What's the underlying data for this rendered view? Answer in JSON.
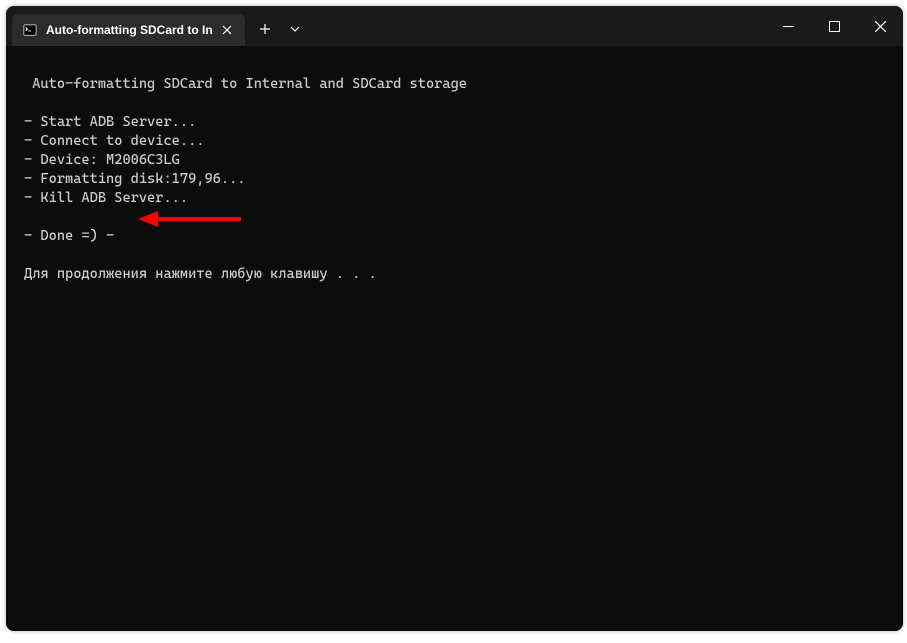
{
  "tab": {
    "title": "Auto-formatting SDCard to In"
  },
  "terminal": {
    "lines": [
      " Auto-formatting SDCard to Internal and SDCard storage",
      "",
      "- Start ADB Server...",
      "- Connect to device...",
      "- Device: M2006C3LG",
      "- Formatting disk:179,96...",
      "- Kill ADB Server...",
      "",
      "- Done =) -",
      "",
      "Для продолжения нажмите любую клавишу . . ."
    ]
  }
}
